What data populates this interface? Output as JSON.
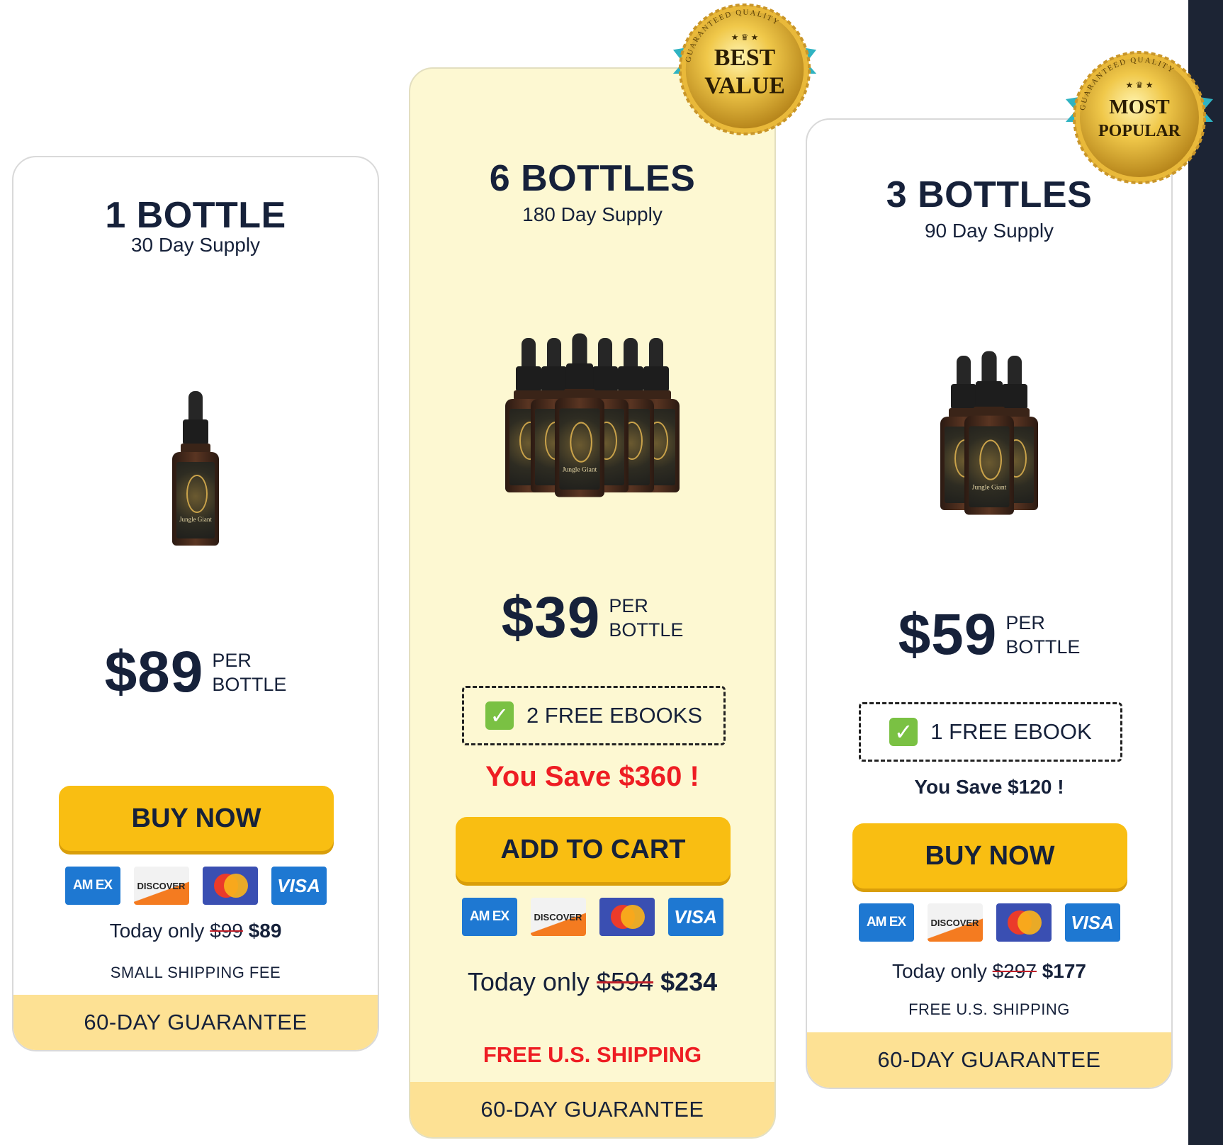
{
  "colors": {
    "button": "#f9be12",
    "guarantee_bar": "#fde194",
    "featured_background": "#fdf8d2",
    "savings_red": "#ee1d23",
    "text_navy": "#16213a",
    "right_band": "#1c2434"
  },
  "badges": {
    "best_value": {
      "line1": "BEST",
      "line2": "VALUE",
      "ring_text": "GUARANTEED QUALITY"
    },
    "most_popular": {
      "line1": "MOST",
      "line2": "POPULAR",
      "ring_text": "GUARANTEED QUALITY"
    }
  },
  "product": {
    "brand": "Jungle Giant"
  },
  "payment_icons": [
    "amex-icon",
    "discover-icon",
    "mastercard-icon",
    "visa-icon"
  ],
  "payment_labels": {
    "amex": "AM EX",
    "discover": "DISCOVER",
    "visa": "VISA"
  },
  "cards": [
    {
      "title": "1 BOTTLE",
      "supply": "30 Day Supply",
      "bottle_count": 1,
      "price": "$89",
      "per_line1": "PER",
      "per_line2": "BOTTLE",
      "button_label": "BUY NOW",
      "today_prefix": "Today only",
      "old_price": "$99",
      "new_price": "$89",
      "shipping": "SMALL SHIPPING FEE",
      "guarantee": "60-DAY GUARANTEE"
    },
    {
      "title": "6 BOTTLES",
      "supply": "180 Day Supply",
      "bottle_count": 6,
      "price": "$39",
      "per_line1": "PER",
      "per_line2": "BOTTLE",
      "bonus": "2 FREE EBOOKS",
      "savings": "You Save $360 !",
      "button_label": "ADD TO CART",
      "today_prefix": "Today only",
      "old_price": "$594",
      "new_price": "$234",
      "shipping": "FREE U.S. SHIPPING",
      "guarantee": "60-DAY GUARANTEE"
    },
    {
      "title": "3 BOTTLES",
      "supply": "90 Day Supply",
      "bottle_count": 3,
      "price": "$59",
      "per_line1": "PER",
      "per_line2": "BOTTLE",
      "bonus": "1 FREE EBOOK",
      "savings": "You Save $120 !",
      "button_label": "BUY NOW",
      "today_prefix": "Today only",
      "old_price": "$297",
      "new_price": "$177",
      "shipping": "FREE U.S. SHIPPING",
      "guarantee": "60-DAY GUARANTEE"
    }
  ]
}
